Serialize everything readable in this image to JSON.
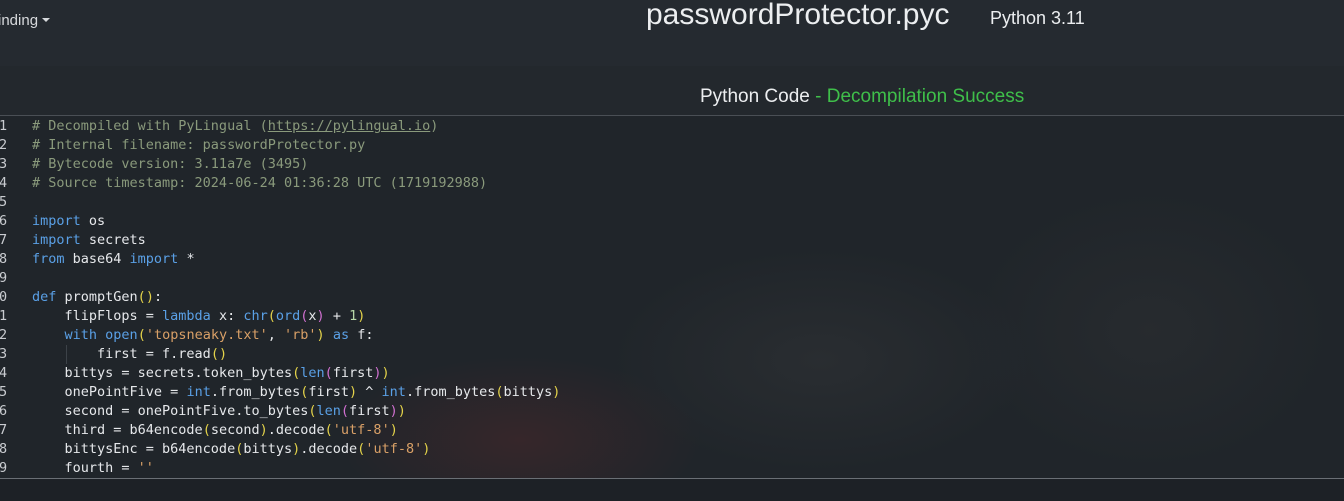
{
  "header": {
    "nav_item": "inding",
    "file_title": "passwordProtector.pyc",
    "python_version": "Python 3.11"
  },
  "panel": {
    "label": "Python Code",
    "status": "- Decompilation Success"
  },
  "code": {
    "line_numbers": [
      "1",
      "2",
      "3",
      "4",
      "5",
      "6",
      "7",
      "8",
      "9",
      "0",
      "1",
      "2",
      "3",
      "4",
      "5",
      "6",
      "7",
      "8",
      "9"
    ],
    "lines": [
      "# Decompiled with PyLingual (https://pylingual.io)",
      "# Internal filename: passwordProtector.py",
      "# Bytecode version: 3.11a7e (3495)",
      "# Source timestamp: 2024-06-24 01:36:28 UTC (1719192988)",
      "",
      "import os",
      "import secrets",
      "from base64 import *",
      "",
      "def promptGen():",
      "    flipFlops = lambda x: chr(ord(x) + 1)",
      "    with open('topsneaky.txt', 'rb') as f:",
      "        first = f.read()",
      "    bittys = secrets.token_bytes(len(first))",
      "    onePointFive = int.from_bytes(first) ^ int.from_bytes(bittys)",
      "    second = onePointFive.to_bytes(len(first))",
      "    third = b64encode(second).decode('utf-8')",
      "    bittysEnc = b64encode(bittys).decode('utf-8')",
      "    fourth = ''"
    ]
  },
  "colors": {
    "background": "#20252a",
    "keyword": "#5aa0e6",
    "comment": "#8a9a7c",
    "string": "#d9a067",
    "success": "#3fbf4a"
  }
}
